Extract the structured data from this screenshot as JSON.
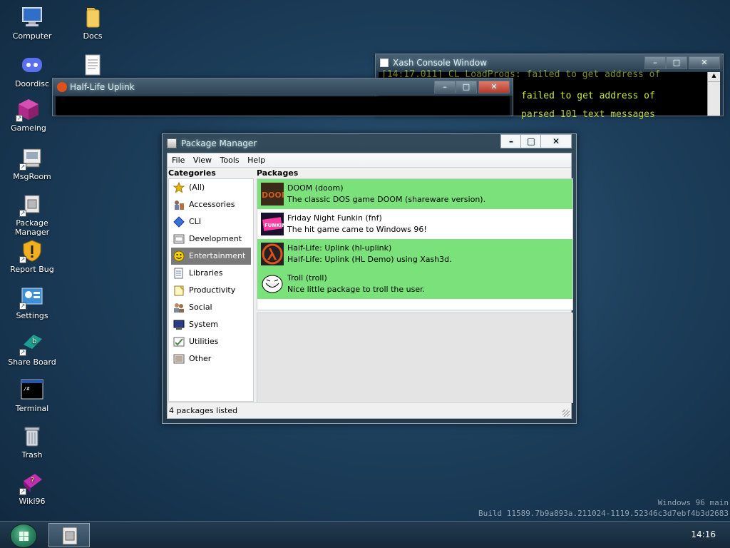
{
  "desktop": {
    "icons": [
      {
        "label": "Computer",
        "icon": "computer-icon"
      },
      {
        "label": "Docs",
        "icon": "folder-icon"
      },
      {
        "label": "Doordisc",
        "icon": "discord-icon"
      },
      {
        "label": "Gameing",
        "icon": "gaming-icon"
      },
      {
        "label": "MsgRoom",
        "icon": "msgroom-icon"
      },
      {
        "label": "Package Manager",
        "icon": "package-icon"
      },
      {
        "label": "Report Bug",
        "icon": "warning-shield-icon"
      },
      {
        "label": "Settings",
        "icon": "settings-icon"
      },
      {
        "label": "Share Board",
        "icon": "shareboard-icon"
      },
      {
        "label": "Terminal",
        "icon": "terminal-icon"
      },
      {
        "label": "Trash",
        "icon": "trash-icon"
      },
      {
        "label": "Wiki96",
        "icon": "wiki-icon"
      }
    ]
  },
  "bg_windows": {
    "console": {
      "title": "Xash Console Window",
      "line1": "[14:17.011] CL_LoadProgs: failed to get address of",
      "line2": "failed to get address of",
      "line3": "parsed 101 text messages"
    },
    "halflife": {
      "title": "Half-Life Uplink"
    }
  },
  "window": {
    "title": "Package Manager",
    "menu": [
      "File",
      "View",
      "Tools",
      "Help"
    ],
    "categories_header": "Categories",
    "packages_header": "Packages",
    "categories": [
      {
        "label": "(All)",
        "icon": "star-icon",
        "color": "#e8b800"
      },
      {
        "label": "Accessories",
        "icon": "accessories-icon",
        "color": "#6a7fb0"
      },
      {
        "label": "CLI",
        "icon": "diamond-icon",
        "color": "#3a6fd8"
      },
      {
        "label": "Development",
        "icon": "development-icon",
        "color": "#6a6a6a"
      },
      {
        "label": "Entertainment",
        "icon": "smiley-icon",
        "color": "#f4d000"
      },
      {
        "label": "Libraries",
        "icon": "libraries-icon",
        "color": "#6a7fb0"
      },
      {
        "label": "Productivity",
        "icon": "productivity-icon",
        "color": "#c9a030"
      },
      {
        "label": "Social",
        "icon": "social-icon",
        "color": "#8a6a50"
      },
      {
        "label": "System",
        "icon": "system-icon",
        "color": "#2a3a8a"
      },
      {
        "label": "Utilities",
        "icon": "utilities-icon",
        "color": "#4a8a4a"
      },
      {
        "label": "Other",
        "icon": "other-icon",
        "color": "#7a6a5a"
      }
    ],
    "selected_category": "Entertainment",
    "packages": [
      {
        "name": "DOOM (doom)",
        "desc": "The classic DOS game DOOM (shareware version).",
        "icon": "doom-icon",
        "highlight": true
      },
      {
        "name": "Friday Night Funkin (fnf)",
        "desc": "The hit game came to Windows 96!",
        "icon": "fnf-icon",
        "highlight": false
      },
      {
        "name": "Half-Life: Uplink (hl-uplink)",
        "desc": "Half-Life: Uplink (HL Demo) using Xash3d.",
        "icon": "halflife-icon",
        "highlight": true
      },
      {
        "name": "Troll (troll)",
        "desc": "Nice little package to troll the user.",
        "icon": "trollface-icon",
        "highlight": true
      }
    ],
    "status": "4 packages listed"
  },
  "watermark": {
    "line1": "Windows 96 main",
    "line2": "Build 11589.7b9a893a.211024-1119.52346c3d7ebf4b3d2683"
  },
  "taskbar": {
    "clock": "14:16"
  },
  "colors": {
    "highlight_green": "#7be27b",
    "selected_category_bg": "#7a7a7a",
    "console_text": "#c8e640"
  }
}
